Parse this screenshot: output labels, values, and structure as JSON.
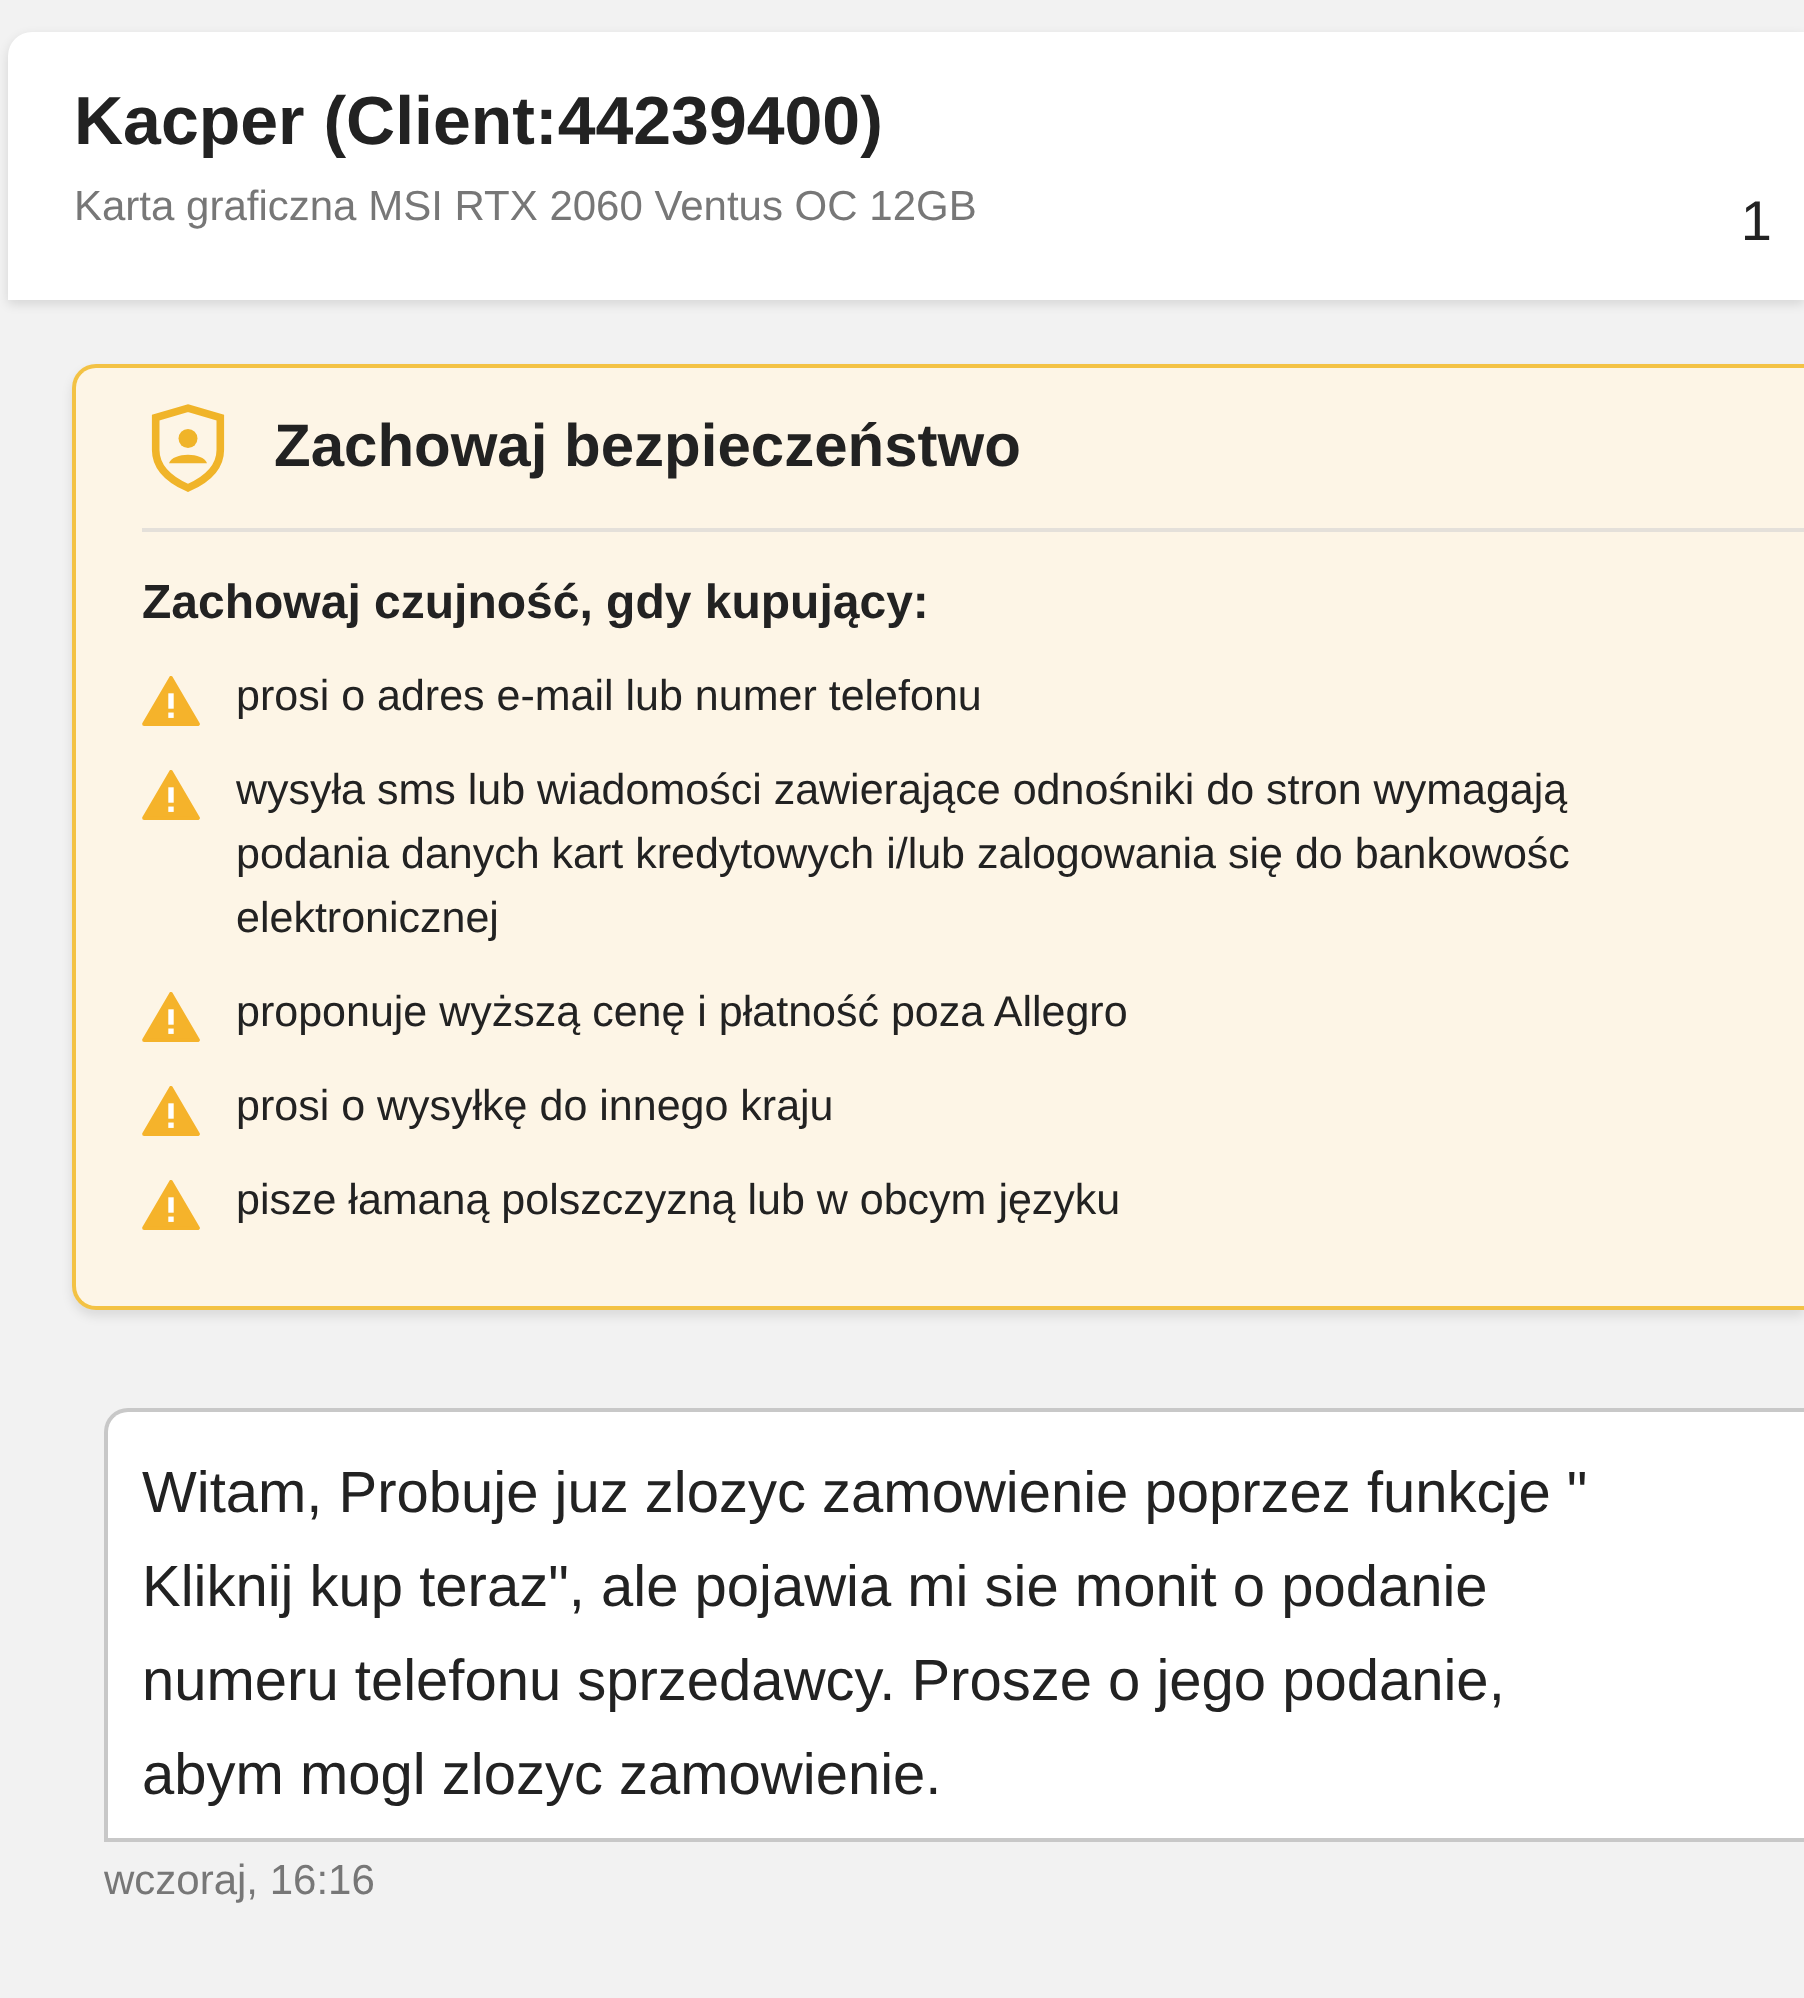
{
  "header": {
    "title": "Kacper (Client:44239400)",
    "subtitle": "Karta graficzna MSI RTX 2060 Ventus OC 12GB",
    "count": "1"
  },
  "safety": {
    "title": "Zachowaj bezpieczeństwo",
    "intro": "Zachowaj czujność, gdy kupujący:",
    "items": [
      {
        "lines": [
          "prosi o adres e-mail lub numer telefonu"
        ]
      },
      {
        "lines": [
          "wysyła sms lub wiadomości zawierające odnośniki do stron wymagają",
          "podania danych kart kredytowych i/lub zalogowania się do bankowośc",
          "elektronicznej"
        ]
      },
      {
        "lines": [
          "proponuje wyższą cenę i płatność poza Allegro"
        ]
      },
      {
        "lines": [
          "prosi o wysyłkę do innego kraju"
        ]
      },
      {
        "lines": [
          "pisze łamaną polszczyzną lub w obcym języku"
        ]
      }
    ]
  },
  "message": {
    "lines": [
      "Witam, Probuje juz zlozyc zamowienie poprzez funkcje \"",
      "Kliknij kup teraz\", ale pojawia mi sie monit o podanie",
      "numeru telefonu sprzedawcy. Prosze o jego podanie,",
      "abym mogl zlozyc zamowienie."
    ],
    "time": "wczoraj, 16:16"
  }
}
